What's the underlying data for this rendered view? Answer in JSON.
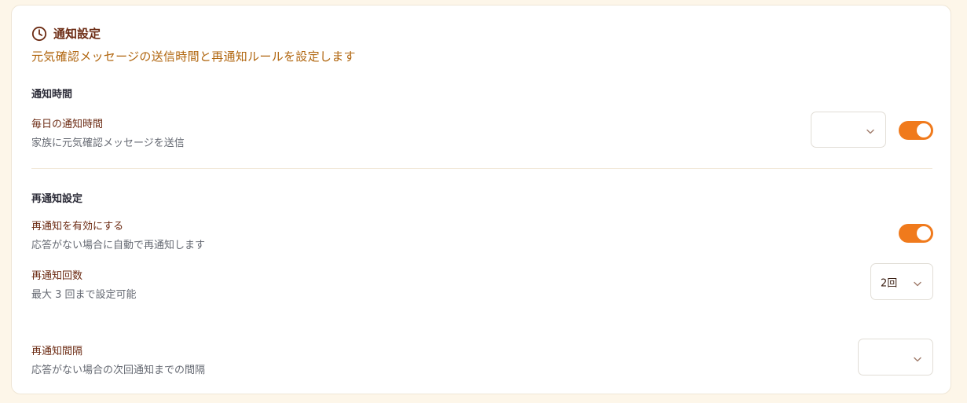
{
  "header": {
    "title": "通知設定",
    "subtitle": "元気確認メッセージの送信時間と再通知ルールを設定します"
  },
  "notification_time": {
    "section_title": "通知時間",
    "daily": {
      "label": "毎日の通知時間",
      "description": "家族に元気確認メッセージを送信",
      "time_value": "",
      "enabled": true
    }
  },
  "renotify": {
    "section_title": "再通知設定",
    "enable": {
      "label": "再通知を有効にする",
      "description": "応答がない場合に自動で再通知します",
      "enabled": true
    },
    "count": {
      "label": "再通知回数",
      "description": "最大 3 回まで設定可能",
      "value": "2回"
    },
    "interval": {
      "label": "再通知間隔",
      "description": "応答がない場合の次回通知までの間隔",
      "value": ""
    }
  },
  "colors": {
    "accent": "#f07a1c",
    "title": "#6b2a12",
    "subtitle": "#b0650e",
    "background": "#fdf6e9"
  },
  "icons": {
    "header_icon": "clock-icon",
    "select_icon": "chevron-down-icon"
  }
}
